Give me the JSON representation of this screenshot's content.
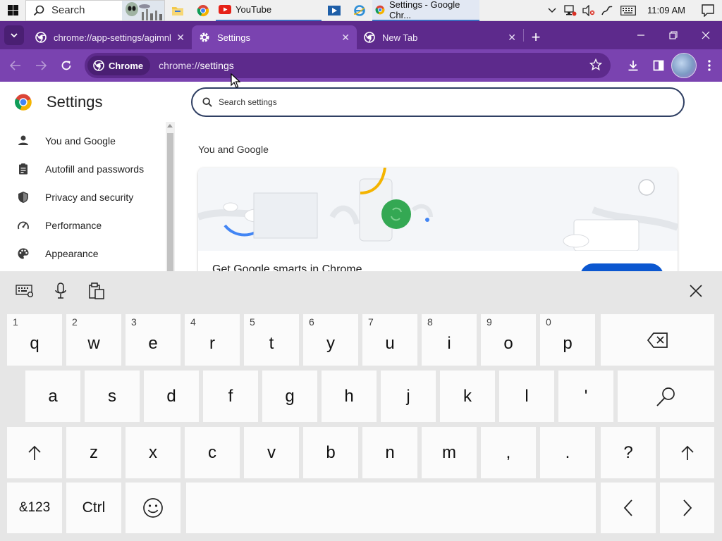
{
  "taskbar": {
    "search_placeholder": "Search",
    "apps": [
      {
        "icon": "file-explorer-icon"
      },
      {
        "icon": "chrome-icon"
      },
      {
        "icon": "youtube-icon",
        "label": "YouTube"
      },
      {
        "icon": "video-app-icon"
      },
      {
        "icon": "internet-explorer-icon"
      },
      {
        "icon": "chrome-icon",
        "label": "Settings - Google Chr..."
      }
    ],
    "clock": "11:09 AM"
  },
  "browser": {
    "tabs": [
      {
        "title": "chrome://app-settings/agimnkij",
        "icon": "chrome-icon"
      },
      {
        "title": "Settings",
        "icon": "gear-icon",
        "active": true
      },
      {
        "title": "New Tab",
        "icon": "chrome-icon"
      }
    ],
    "chip_label": "Chrome",
    "url": {
      "scheme": "chrome://",
      "path": "settings"
    }
  },
  "settings": {
    "title": "Settings",
    "search_placeholder": "Search settings",
    "nav": [
      {
        "label": "You and Google",
        "icon": "person-icon"
      },
      {
        "label": "Autofill and passwords",
        "icon": "clipboard-icon"
      },
      {
        "label": "Privacy and security",
        "icon": "shield-icon"
      },
      {
        "label": "Performance",
        "icon": "speedometer-icon"
      },
      {
        "label": "Appearance",
        "icon": "palette-icon"
      }
    ],
    "section_title": "You and Google",
    "card_headline": "Get Google smarts in Chrome"
  },
  "keyboard": {
    "row1": [
      {
        "key": "q",
        "num": "1"
      },
      {
        "key": "w",
        "num": "2"
      },
      {
        "key": "e",
        "num": "3"
      },
      {
        "key": "r",
        "num": "4"
      },
      {
        "key": "t",
        "num": "5"
      },
      {
        "key": "y",
        "num": "6"
      },
      {
        "key": "u",
        "num": "7"
      },
      {
        "key": "i",
        "num": "8"
      },
      {
        "key": "o",
        "num": "9"
      },
      {
        "key": "p",
        "num": "0"
      }
    ],
    "row2": [
      "a",
      "s",
      "d",
      "f",
      "g",
      "h",
      "j",
      "k",
      "l",
      "'"
    ],
    "row3": [
      "z",
      "x",
      "c",
      "v",
      "b",
      "n",
      "m",
      ",",
      ".",
      "?"
    ],
    "symbols_label": "&123",
    "ctrl_label": "Ctrl"
  }
}
